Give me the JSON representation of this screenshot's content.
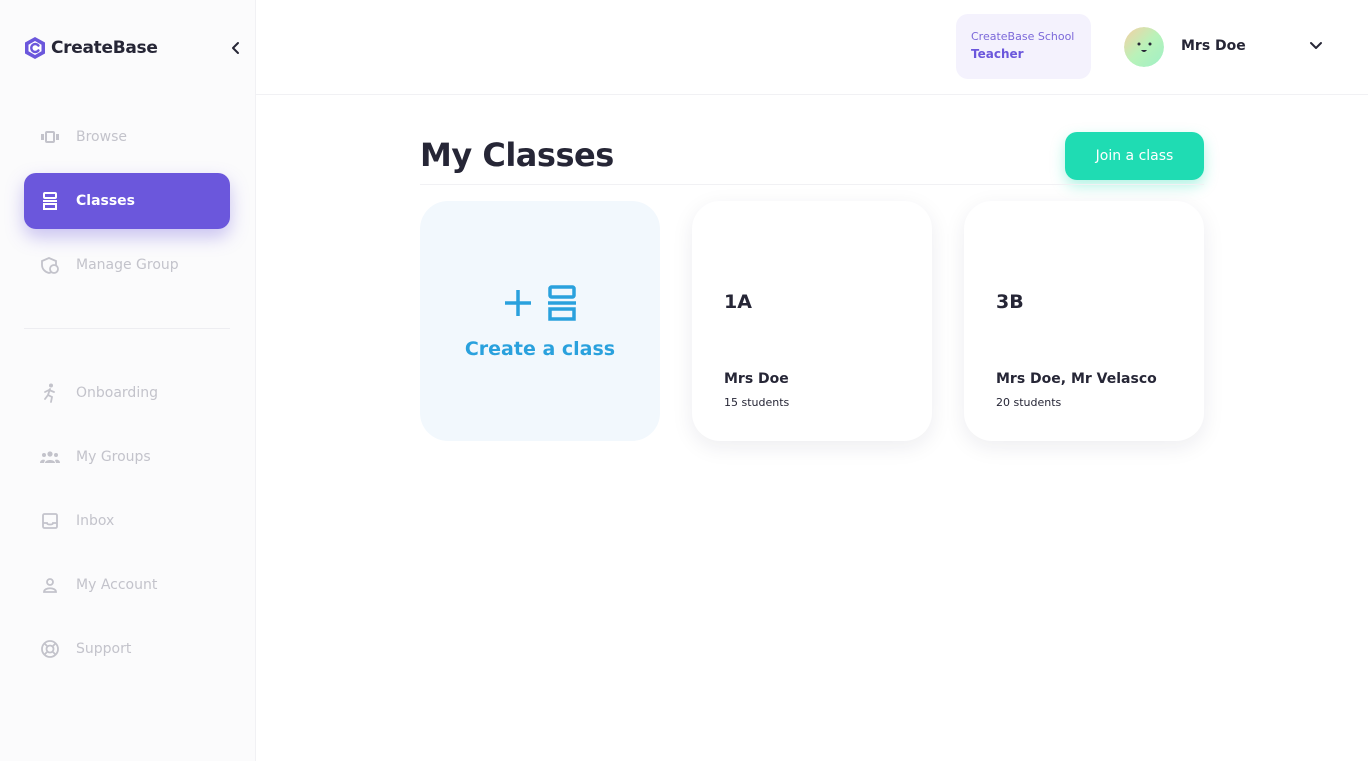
{
  "brand": {
    "name": "CreateBase",
    "logo_icon": "createbase-logo-icon",
    "accent": "#6b57dc"
  },
  "sidebar": {
    "collapse_icon": "chevron-left-icon",
    "items": [
      {
        "label": "Browse",
        "icon": "browse-icon",
        "active": false
      },
      {
        "label": "Classes",
        "icon": "classes-icon",
        "active": true
      },
      {
        "label": "Manage Group",
        "icon": "manage-group-icon",
        "active": false
      },
      {
        "label": "Onboarding",
        "icon": "onboarding-icon",
        "active": false
      },
      {
        "label": "My Groups",
        "icon": "groups-icon",
        "active": false
      },
      {
        "label": "Inbox",
        "icon": "inbox-icon",
        "active": false
      },
      {
        "label": "My Account",
        "icon": "account-icon",
        "active": false
      },
      {
        "label": "Support",
        "icon": "support-icon",
        "active": false
      }
    ]
  },
  "header": {
    "school": {
      "name": "CreateBase School",
      "role": "Teacher"
    },
    "user": {
      "name": "Mrs Doe",
      "avatar_icon": "smiley-avatar-icon",
      "menu_icon": "chevron-down-icon"
    }
  },
  "main": {
    "title": "My Classes",
    "join_button": "Join a class",
    "create_card": {
      "label": "Create a class",
      "color": "#2aa1dd"
    },
    "classes": [
      {
        "name": "1A",
        "teachers": "Mrs Doe",
        "students": "15 students"
      },
      {
        "name": "3B",
        "teachers": "Mrs Doe, Mr Velasco",
        "students": "20 students"
      }
    ]
  },
  "colors": {
    "join_button": "#1fdcb3",
    "active_nav": "#6b57dc",
    "muted_text": "#c3c3cb"
  }
}
